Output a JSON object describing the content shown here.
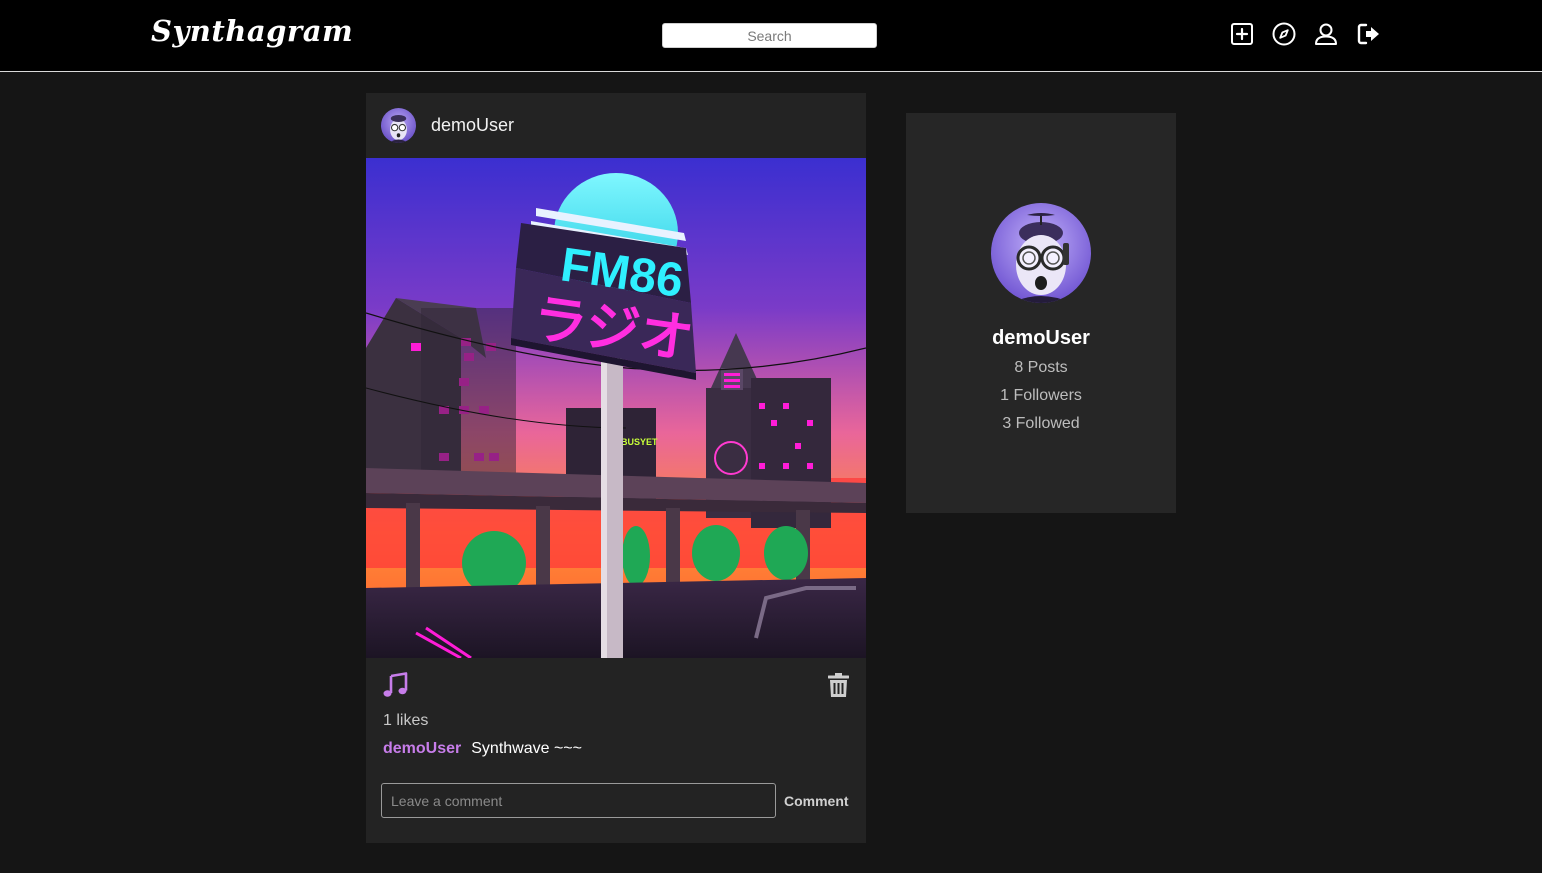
{
  "app": {
    "logo_text": "Synthagram"
  },
  "header": {
    "search_placeholder": "Search",
    "icons": [
      "add-post-icon",
      "explore-compass-icon",
      "profile-user-icon",
      "logout-icon"
    ]
  },
  "post": {
    "username": "demoUser",
    "image_text": {
      "sign_line1": "FM86",
      "sign_line2": "ラジオ",
      "shop_sign": "BUSYET"
    },
    "likes_text": "1 likes",
    "caption_user": "demoUser",
    "caption_text": "Synthwave ~~~",
    "comment_placeholder": "Leave a comment",
    "comment_button_label": "Comment",
    "like_icon": "music-note-icon",
    "delete_icon": "trash-icon"
  },
  "profile": {
    "username": "demoUser",
    "posts": "8 Posts",
    "followers": "1 Followers",
    "followed": "3 Followed"
  },
  "colors": {
    "accent": "#c77dea",
    "background": "#151515",
    "card": "#232323",
    "topbar": "#000000"
  }
}
